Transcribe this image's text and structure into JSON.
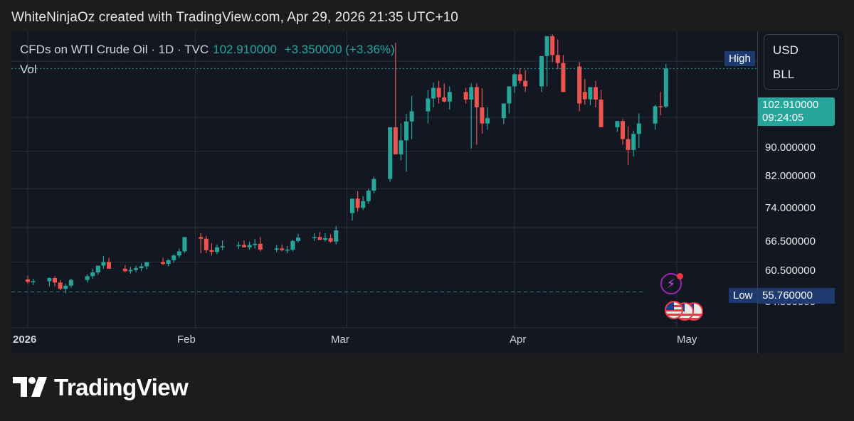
{
  "header": {
    "attribution": "WhiteNinjaOz created with TradingView.com, Apr 29, 2026 21:35 UTC+10"
  },
  "legend": {
    "symbol": "CFDs on WTI Crude Oil · 1D · TVC",
    "last": "102.910000",
    "change": "+3.350000 (+3.36%)",
    "volume_label": "Vol"
  },
  "currency": {
    "unit1": "USD",
    "unit2": "BLL"
  },
  "price_axis": {
    "ticks": [
      "90.000000",
      "82.000000",
      "74.000000",
      "66.500000",
      "60.500000",
      "54.500000"
    ],
    "last_price": "102.910000",
    "countdown": "09:24:05",
    "low_label": "Low",
    "low_value": "55.760000",
    "high_label": "High"
  },
  "time_axis": {
    "labels": [
      "2026",
      "Feb",
      "Mar",
      "Apr",
      "May"
    ]
  },
  "brand": {
    "name": "TradingView"
  },
  "colors": {
    "up": "#26a69a",
    "down": "#ef5350",
    "background": "#131722",
    "grid": "#2a2e39",
    "badge": "#1e3a6e"
  },
  "chart_data": {
    "type": "candlestick",
    "title": "CFDs on WTI Crude Oil · 1D · TVC",
    "ylabel": "USD / BLL",
    "ylim": [
      50.5,
      114
    ],
    "scale": "log",
    "x": [
      "2026-01-01",
      "2026-01-02",
      "2026-01-05",
      "2026-01-06",
      "2026-01-07",
      "2026-01-08",
      "2026-01-09",
      "2026-01-12",
      "2026-01-13",
      "2026-01-14",
      "2026-01-15",
      "2026-01-16",
      "2026-01-19",
      "2026-01-20",
      "2026-01-21",
      "2026-01-22",
      "2026-01-23",
      "2026-01-26",
      "2026-01-27",
      "2026-01-28",
      "2026-01-29",
      "2026-01-30",
      "2026-02-02",
      "2026-02-03",
      "2026-02-04",
      "2026-02-05",
      "2026-02-06",
      "2026-02-09",
      "2026-02-10",
      "2026-02-11",
      "2026-02-12",
      "2026-02-13",
      "2026-02-16",
      "2026-02-17",
      "2026-02-18",
      "2026-02-19",
      "2026-02-20",
      "2026-02-23",
      "2026-02-24",
      "2026-02-25",
      "2026-02-26",
      "2026-02-27",
      "2026-03-02",
      "2026-03-03",
      "2026-03-04",
      "2026-03-05",
      "2026-03-06",
      "2026-03-09",
      "2026-03-10",
      "2026-03-11",
      "2026-03-12",
      "2026-03-13",
      "2026-03-16",
      "2026-03-17",
      "2026-03-18",
      "2026-03-19",
      "2026-03-20",
      "2026-03-23",
      "2026-03-24",
      "2026-03-25",
      "2026-03-26",
      "2026-03-27",
      "2026-03-30",
      "2026-03-31",
      "2026-04-01",
      "2026-04-02",
      "2026-04-03",
      "2026-04-06",
      "2026-04-07",
      "2026-04-08",
      "2026-04-09",
      "2026-04-10",
      "2026-04-13",
      "2026-04-14",
      "2026-04-15",
      "2026-04-16",
      "2026-04-17",
      "2026-04-20",
      "2026-04-21",
      "2026-04-22",
      "2026-04-23",
      "2026-04-24",
      "2026-04-27",
      "2026-04-28",
      "2026-04-29"
    ],
    "open": [
      57.7,
      57.3,
      57.4,
      57.9,
      57.2,
      56.2,
      56.7,
      57.6,
      58.2,
      58.8,
      59.9,
      60.5,
      59.4,
      59.0,
      59.2,
      59.5,
      59.8,
      60.5,
      60.2,
      60.8,
      61.6,
      62.3,
      64.8,
      64.5,
      62.5,
      62.2,
      63.0,
      63.2,
      63.4,
      63.0,
      63.4,
      63.6,
      62.6,
      62.8,
      62.5,
      62.6,
      64.1,
      64.7,
      64.8,
      64.3,
      64.6,
      64.0,
      69.2,
      72.0,
      70.2,
      71.5,
      73.6,
      76.0,
      87.6,
      81.3,
      84.5,
      89.0,
      91.5,
      94.8,
      97.6,
      95.1,
      94.0,
      96.5,
      94.5,
      97.8,
      92.5,
      88.5,
      89.8,
      93.5,
      98.0,
      101.3,
      99.5,
      98.0,
      106.5,
      112.5,
      106.8,
      104.5,
      103.5,
      96.5,
      94.6,
      97.8,
      94.5,
      87.6,
      89.1,
      84.8,
      82.3,
      86.0,
      88.5,
      92.8,
      92.7
    ],
    "high": [
      58.3,
      57.8,
      58.0,
      58.2,
      57.6,
      57.0,
      57.8,
      58.5,
      59.4,
      59.6,
      61.5,
      61.2,
      60.0,
      59.7,
      59.9,
      60.3,
      60.5,
      61.2,
      61.0,
      61.8,
      62.8,
      64.0,
      65.5,
      65.0,
      63.7,
      63.5,
      64.2,
      64.0,
      64.2,
      64.0,
      64.5,
      64.8,
      63.4,
      63.5,
      63.2,
      64.3,
      65.4,
      65.5,
      65.7,
      65.5,
      65.3,
      66.8,
      70.8,
      73.5,
      72.5,
      74.0,
      76.5,
      81.0,
      110.5,
      88.5,
      90.8,
      95.5,
      97.0,
      99.0,
      99.5,
      98.8,
      98.0,
      97.6,
      98.8,
      98.8,
      97.5,
      92.5,
      93.0,
      96.4,
      101.6,
      103.0,
      102.5,
      102.0,
      111.0,
      113.0,
      111.5,
      106.8,
      104.8,
      100.0,
      97.6,
      99.5,
      97.0,
      88.5,
      89.6,
      87.8,
      86.8,
      91.0,
      93.2,
      96.5,
      104.2
    ],
    "low": [
      57.0,
      56.8,
      56.6,
      56.6,
      56.0,
      55.5,
      56.4,
      57.2,
      57.8,
      58.4,
      59.4,
      59.7,
      58.8,
      58.6,
      58.8,
      59.0,
      59.3,
      60.0,
      59.8,
      60.4,
      61.2,
      62.0,
      62.0,
      62.0,
      61.6,
      61.8,
      62.5,
      62.7,
      63.0,
      62.6,
      62.8,
      62.3,
      62.2,
      62.3,
      62.0,
      62.3,
      63.8,
      64.1,
      64.3,
      64.0,
      63.8,
      63.5,
      67.8,
      69.5,
      69.8,
      71.0,
      73.0,
      75.4,
      84.0,
      80.0,
      77.5,
      84.8,
      88.5,
      92.5,
      93.5,
      93.8,
      92.0,
      93.5,
      82.6,
      83.5,
      86.0,
      87.0,
      88.4,
      91.0,
      96.3,
      98.7,
      96.5,
      96.5,
      98.0,
      104.8,
      102.8,
      100.0,
      91.5,
      93.2,
      93.0,
      92.5,
      87.6,
      86.5,
      83.5,
      79.0,
      80.8,
      82.8,
      87.0,
      90.5,
      92.3
    ],
    "close": [
      57.3,
      57.4,
      57.9,
      57.2,
      56.2,
      56.7,
      57.6,
      58.2,
      58.8,
      59.9,
      60.5,
      59.4,
      59.0,
      59.2,
      59.5,
      59.8,
      60.5,
      60.2,
      60.8,
      61.6,
      62.3,
      64.8,
      64.5,
      62.5,
      62.2,
      63.0,
      63.2,
      63.4,
      63.0,
      63.4,
      63.6,
      62.6,
      62.8,
      62.5,
      62.6,
      64.1,
      64.7,
      64.8,
      64.3,
      64.6,
      64.0,
      66.0,
      72.0,
      70.2,
      71.5,
      73.6,
      76.0,
      87.6,
      81.3,
      84.5,
      89.0,
      91.5,
      94.8,
      97.6,
      95.1,
      94.0,
      96.5,
      94.5,
      97.8,
      92.5,
      88.5,
      89.8,
      93.5,
      98.0,
      101.3,
      99.5,
      98.0,
      106.5,
      112.5,
      106.8,
      104.5,
      96.5,
      93.5,
      94.6,
      97.8,
      94.5,
      87.6,
      89.1,
      84.8,
      82.3,
      86.0,
      88.5,
      92.8,
      92.7,
      102.91
    ]
  }
}
